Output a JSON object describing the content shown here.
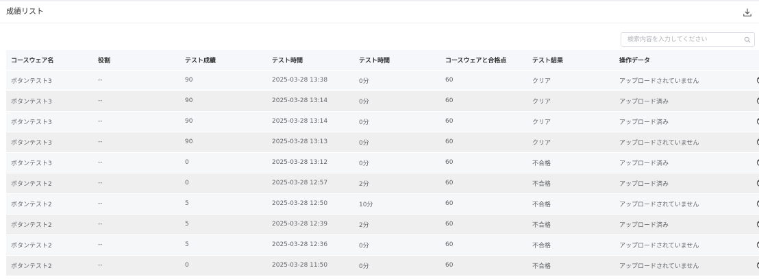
{
  "header": {
    "title": "成績リスト",
    "download_icon": "download-icon"
  },
  "search": {
    "placeholder": "検索内容を入力してください",
    "value": "",
    "icon": "search-icon"
  },
  "table": {
    "columns": [
      "コースウェア名",
      "役割",
      "テスト成績",
      "テスト時間",
      "テスト時間",
      "コースウェアと合格点",
      "テスト結果",
      "操作データ",
      ""
    ],
    "rows": [
      [
        "ボタンテスト3",
        "--",
        "90",
        "2025-03-28 13:38",
        "0分",
        "60",
        "クリア",
        "アップロードされていません"
      ],
      [
        "ボタンテスト3",
        "--",
        "90",
        "2025-03-28 13:14",
        "0分",
        "60",
        "クリア",
        "アップロード済み"
      ],
      [
        "ボタンテスト3",
        "--",
        "90",
        "2025-03-28 13:14",
        "0分",
        "60",
        "クリア",
        "アップロード済み"
      ],
      [
        "ボタンテスト3",
        "--",
        "90",
        "2025-03-28 13:13",
        "0分",
        "60",
        "クリア",
        "アップロードされていません"
      ],
      [
        "ボタンテスト3",
        "--",
        "0",
        "2025-03-28 13:12",
        "0分",
        "60",
        "不合格",
        "アップロード済み"
      ],
      [
        "ボタンテスト2",
        "--",
        "0",
        "2025-03-28 12:57",
        "2分",
        "60",
        "不合格",
        "アップロード済み"
      ],
      [
        "ボタンテスト2",
        "--",
        "5",
        "2025-03-28 12:50",
        "10分",
        "60",
        "不合格",
        "アップロードされていません"
      ],
      [
        "ボタンテスト2",
        "--",
        "5",
        "2025-03-28 12:39",
        "2分",
        "60",
        "不合格",
        "アップロード済み"
      ],
      [
        "ボタンテスト2",
        "--",
        "5",
        "2025-03-28 12:36",
        "0分",
        "60",
        "不合格",
        "アップロードされていません"
      ],
      [
        "ボタンテスト2",
        "--",
        "0",
        "2025-03-28 11:50",
        "0分",
        "60",
        "不合格",
        "アップロードされていません"
      ]
    ],
    "row_action_icon": "disabled-icon"
  }
}
